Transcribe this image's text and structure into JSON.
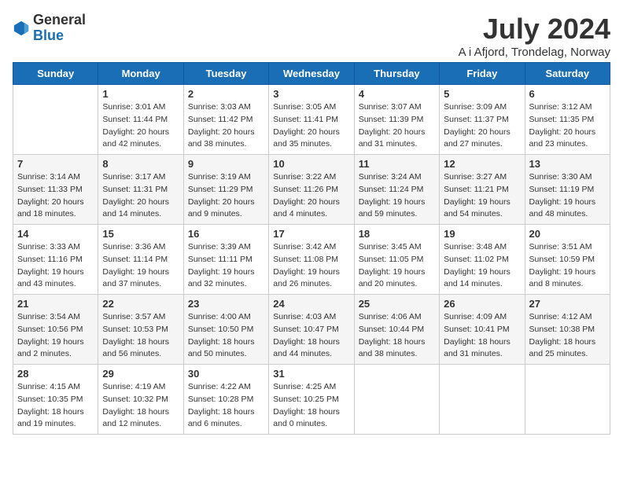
{
  "logo": {
    "general": "General",
    "blue": "Blue"
  },
  "title": "July 2024",
  "subtitle": "A i Afjord, Trondelag, Norway",
  "weekdays": [
    "Sunday",
    "Monday",
    "Tuesday",
    "Wednesday",
    "Thursday",
    "Friday",
    "Saturday"
  ],
  "weeks": [
    [
      {
        "day": "",
        "info": ""
      },
      {
        "day": "1",
        "info": "Sunrise: 3:01 AM\nSunset: 11:44 PM\nDaylight: 20 hours\nand 42 minutes."
      },
      {
        "day": "2",
        "info": "Sunrise: 3:03 AM\nSunset: 11:42 PM\nDaylight: 20 hours\nand 38 minutes."
      },
      {
        "day": "3",
        "info": "Sunrise: 3:05 AM\nSunset: 11:41 PM\nDaylight: 20 hours\nand 35 minutes."
      },
      {
        "day": "4",
        "info": "Sunrise: 3:07 AM\nSunset: 11:39 PM\nDaylight: 20 hours\nand 31 minutes."
      },
      {
        "day": "5",
        "info": "Sunrise: 3:09 AM\nSunset: 11:37 PM\nDaylight: 20 hours\nand 27 minutes."
      },
      {
        "day": "6",
        "info": "Sunrise: 3:12 AM\nSunset: 11:35 PM\nDaylight: 20 hours\nand 23 minutes."
      }
    ],
    [
      {
        "day": "7",
        "info": "Sunrise: 3:14 AM\nSunset: 11:33 PM\nDaylight: 20 hours\nand 18 minutes."
      },
      {
        "day": "8",
        "info": "Sunrise: 3:17 AM\nSunset: 11:31 PM\nDaylight: 20 hours\nand 14 minutes."
      },
      {
        "day": "9",
        "info": "Sunrise: 3:19 AM\nSunset: 11:29 PM\nDaylight: 20 hours\nand 9 minutes."
      },
      {
        "day": "10",
        "info": "Sunrise: 3:22 AM\nSunset: 11:26 PM\nDaylight: 20 hours\nand 4 minutes."
      },
      {
        "day": "11",
        "info": "Sunrise: 3:24 AM\nSunset: 11:24 PM\nDaylight: 19 hours\nand 59 minutes."
      },
      {
        "day": "12",
        "info": "Sunrise: 3:27 AM\nSunset: 11:21 PM\nDaylight: 19 hours\nand 54 minutes."
      },
      {
        "day": "13",
        "info": "Sunrise: 3:30 AM\nSunset: 11:19 PM\nDaylight: 19 hours\nand 48 minutes."
      }
    ],
    [
      {
        "day": "14",
        "info": "Sunrise: 3:33 AM\nSunset: 11:16 PM\nDaylight: 19 hours\nand 43 minutes."
      },
      {
        "day": "15",
        "info": "Sunrise: 3:36 AM\nSunset: 11:14 PM\nDaylight: 19 hours\nand 37 minutes."
      },
      {
        "day": "16",
        "info": "Sunrise: 3:39 AM\nSunset: 11:11 PM\nDaylight: 19 hours\nand 32 minutes."
      },
      {
        "day": "17",
        "info": "Sunrise: 3:42 AM\nSunset: 11:08 PM\nDaylight: 19 hours\nand 26 minutes."
      },
      {
        "day": "18",
        "info": "Sunrise: 3:45 AM\nSunset: 11:05 PM\nDaylight: 19 hours\nand 20 minutes."
      },
      {
        "day": "19",
        "info": "Sunrise: 3:48 AM\nSunset: 11:02 PM\nDaylight: 19 hours\nand 14 minutes."
      },
      {
        "day": "20",
        "info": "Sunrise: 3:51 AM\nSunset: 10:59 PM\nDaylight: 19 hours\nand 8 minutes."
      }
    ],
    [
      {
        "day": "21",
        "info": "Sunrise: 3:54 AM\nSunset: 10:56 PM\nDaylight: 19 hours\nand 2 minutes."
      },
      {
        "day": "22",
        "info": "Sunrise: 3:57 AM\nSunset: 10:53 PM\nDaylight: 18 hours\nand 56 minutes."
      },
      {
        "day": "23",
        "info": "Sunrise: 4:00 AM\nSunset: 10:50 PM\nDaylight: 18 hours\nand 50 minutes."
      },
      {
        "day": "24",
        "info": "Sunrise: 4:03 AM\nSunset: 10:47 PM\nDaylight: 18 hours\nand 44 minutes."
      },
      {
        "day": "25",
        "info": "Sunrise: 4:06 AM\nSunset: 10:44 PM\nDaylight: 18 hours\nand 38 minutes."
      },
      {
        "day": "26",
        "info": "Sunrise: 4:09 AM\nSunset: 10:41 PM\nDaylight: 18 hours\nand 31 minutes."
      },
      {
        "day": "27",
        "info": "Sunrise: 4:12 AM\nSunset: 10:38 PM\nDaylight: 18 hours\nand 25 minutes."
      }
    ],
    [
      {
        "day": "28",
        "info": "Sunrise: 4:15 AM\nSunset: 10:35 PM\nDaylight: 18 hours\nand 19 minutes."
      },
      {
        "day": "29",
        "info": "Sunrise: 4:19 AM\nSunset: 10:32 PM\nDaylight: 18 hours\nand 12 minutes."
      },
      {
        "day": "30",
        "info": "Sunrise: 4:22 AM\nSunset: 10:28 PM\nDaylight: 18 hours\nand 6 minutes."
      },
      {
        "day": "31",
        "info": "Sunrise: 4:25 AM\nSunset: 10:25 PM\nDaylight: 18 hours\nand 0 minutes."
      },
      {
        "day": "",
        "info": ""
      },
      {
        "day": "",
        "info": ""
      },
      {
        "day": "",
        "info": ""
      }
    ]
  ]
}
